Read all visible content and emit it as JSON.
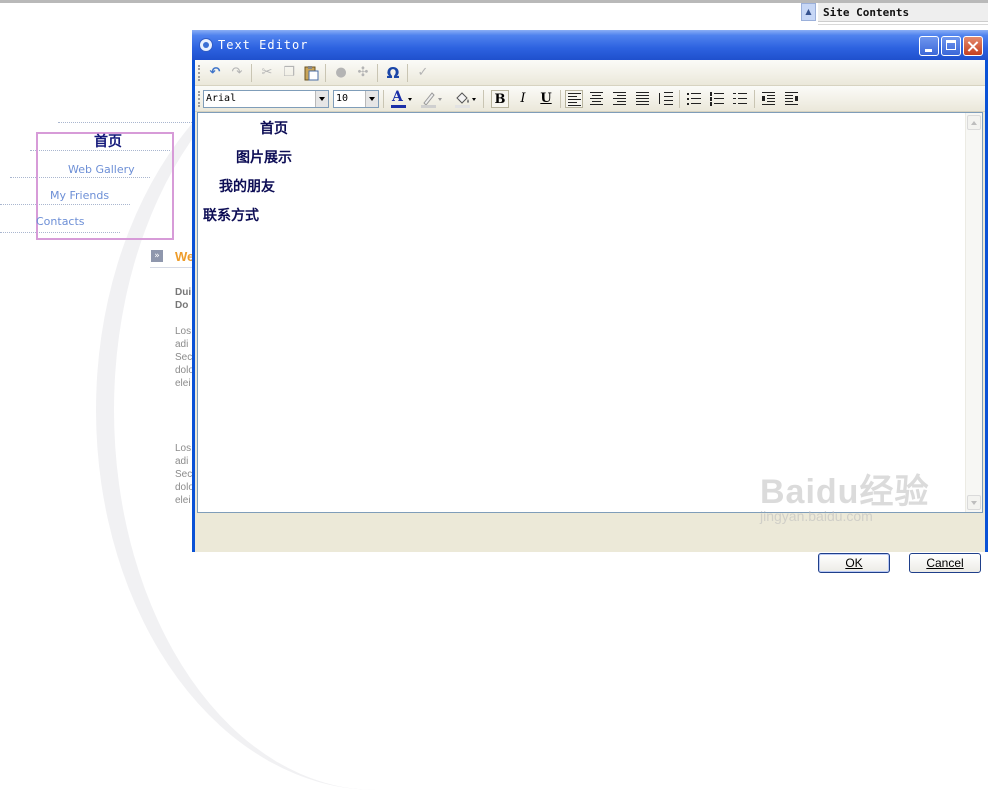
{
  "background_page": {
    "nav": {
      "home": "首页",
      "items": [
        "Web Gallery",
        "My Friends",
        "Contacts"
      ]
    },
    "section_heading": "We",
    "text_fragments": [
      "Dui",
      "Do",
      "Los",
      "adi",
      "Sec",
      "dolo",
      "elei",
      "Los",
      "adi",
      "Sec",
      "dolo",
      "elei"
    ],
    "site_contents_title": "Site Contents"
  },
  "dialog": {
    "title": "Text Editor",
    "toolbar1": {
      "icons": [
        "undo-icon",
        "redo-icon",
        "cut-icon",
        "copy-icon",
        "paste-icon",
        "link-icon",
        "unlink-icon",
        "special-character-icon",
        "spellcheck-icon"
      ],
      "omega_glyph": "Ω"
    },
    "toolbar2": {
      "font_name": "Arial",
      "font_size": "10",
      "font_color": "#1a2fa8",
      "highlight_color": "#cfcfcf",
      "background_color": "#e2e2e2",
      "bold": "B",
      "italic": "I",
      "underline": "U",
      "foreground_glyph": "A"
    },
    "editor_lines": [
      "首页",
      "图片展示",
      "我的朋友",
      "联系方式"
    ],
    "ok_label": "OK",
    "cancel_label": "Cancel"
  },
  "watermark": {
    "brand": "Baidu经验",
    "url": "jingyan.baidu.com"
  },
  "colors": {
    "titlebar": "#2d62e0",
    "nav_border": "#d79bd8",
    "nav_link": "#6d8fd6",
    "editor_text": "#0d0d55",
    "accent_heading": "#ee9c2a"
  }
}
